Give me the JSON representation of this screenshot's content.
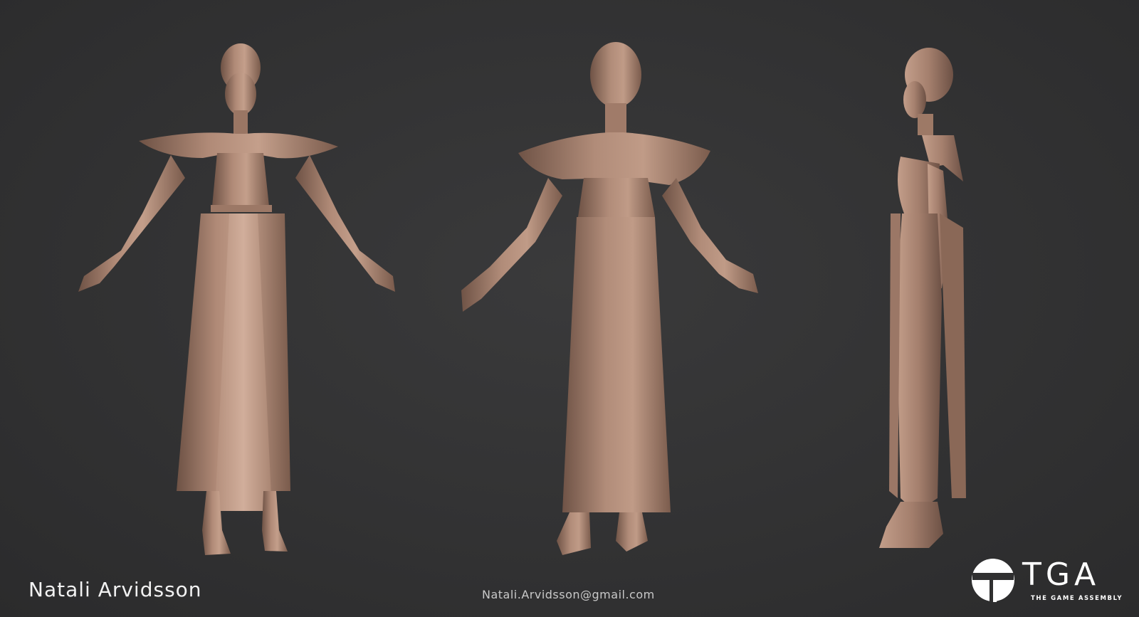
{
  "artist": {
    "name": "Natali Arvidsson"
  },
  "contact": {
    "email": "Natali.Arvidsson@gmail.com"
  },
  "logo": {
    "acronym": "TGA",
    "full_name": "THE GAME ASSEMBLY"
  },
  "views": [
    {
      "id": "front",
      "icon": "character-front-view"
    },
    {
      "id": "back",
      "icon": "character-back-view"
    },
    {
      "id": "side",
      "icon": "character-side-view"
    }
  ],
  "colors": {
    "background": "#333334",
    "clay": "#a47f6d",
    "clay_light": "#c29d89",
    "clay_dark": "#6e5245",
    "text": "#f2f2f2"
  }
}
